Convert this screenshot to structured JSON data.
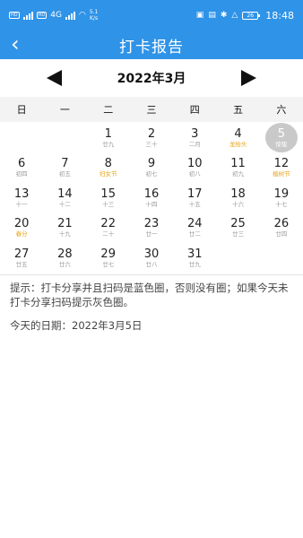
{
  "status_bar": {
    "hd1": "HD",
    "hd2": "HD",
    "net": "4G",
    "speed_value": "5.1",
    "speed_unit": "K/s",
    "battery": "26",
    "time": "18:48"
  },
  "app_bar": {
    "title": "打卡报告",
    "back_icon": "back-chevron-icon"
  },
  "calendar": {
    "month_label": "2022年3月",
    "weekdays": [
      "日",
      "一",
      "二",
      "三",
      "四",
      "五",
      "六"
    ],
    "cells": [
      {
        "day": "",
        "lunar": ""
      },
      {
        "day": "",
        "lunar": ""
      },
      {
        "day": "1",
        "lunar": "廿九"
      },
      {
        "day": "2",
        "lunar": "三十"
      },
      {
        "day": "3",
        "lunar": "二月"
      },
      {
        "day": "4",
        "lunar": "龙抬头",
        "festival": true
      },
      {
        "day": "5",
        "lunar": "惊蛰",
        "today": true
      },
      {
        "day": "6",
        "lunar": "初四"
      },
      {
        "day": "7",
        "lunar": "初五"
      },
      {
        "day": "8",
        "lunar": "妇女节",
        "festival": true
      },
      {
        "day": "9",
        "lunar": "初七"
      },
      {
        "day": "10",
        "lunar": "初八"
      },
      {
        "day": "11",
        "lunar": "初九"
      },
      {
        "day": "12",
        "lunar": "植树节",
        "festival": true
      },
      {
        "day": "13",
        "lunar": "十一"
      },
      {
        "day": "14",
        "lunar": "十二"
      },
      {
        "day": "15",
        "lunar": "十三"
      },
      {
        "day": "16",
        "lunar": "十四"
      },
      {
        "day": "17",
        "lunar": "十五"
      },
      {
        "day": "18",
        "lunar": "十六"
      },
      {
        "day": "19",
        "lunar": "十七"
      },
      {
        "day": "20",
        "lunar": "春分",
        "festival": true
      },
      {
        "day": "21",
        "lunar": "十九"
      },
      {
        "day": "22",
        "lunar": "二十"
      },
      {
        "day": "23",
        "lunar": "廿一"
      },
      {
        "day": "24",
        "lunar": "廿二"
      },
      {
        "day": "25",
        "lunar": "廿三"
      },
      {
        "day": "26",
        "lunar": "廿四"
      },
      {
        "day": "27",
        "lunar": "廿五"
      },
      {
        "day": "28",
        "lunar": "廿六"
      },
      {
        "day": "29",
        "lunar": "廿七"
      },
      {
        "day": "30",
        "lunar": "廿八"
      },
      {
        "day": "31",
        "lunar": "廿九"
      }
    ]
  },
  "hint_text": "提示：打卡分享并且扫码是蓝色圈，否则没有圈；如果今天未打卡分享扫码提示灰色圈。",
  "today_text": "今天的日期：2022年3月5日",
  "colors": {
    "primary": "#2f93e8",
    "festival": "#e6a317",
    "today_circle": "#c9c9c9"
  }
}
